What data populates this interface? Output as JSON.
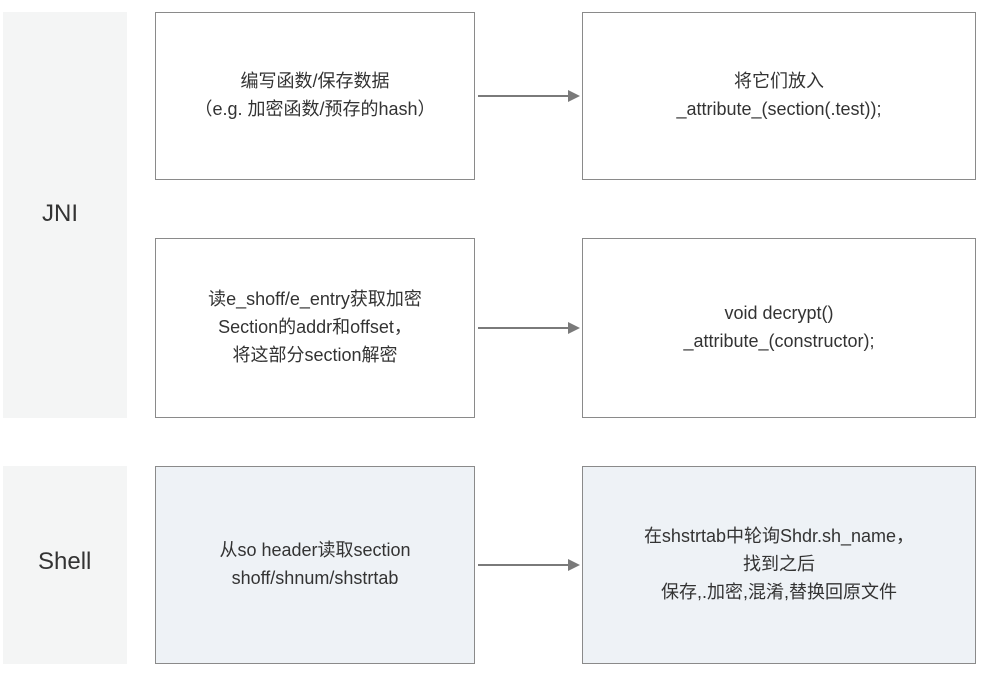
{
  "sections": {
    "jni": {
      "label": "JNI"
    },
    "shell": {
      "label": "Shell"
    }
  },
  "jni_row1": {
    "left": {
      "line1": "编写函数/保存数据",
      "line2": "（e.g. 加密函数/预存的hash）"
    },
    "right": {
      "line1": "将它们放入",
      "line2": "_attribute_(section(.test));"
    }
  },
  "jni_row2": {
    "left": {
      "line1": "读e_shoff/e_entry获取加密",
      "line2": "Section的addr和offset，",
      "line3": "将这部分section解密"
    },
    "right": {
      "line1": "void decrypt()",
      "line2": "_attribute_(constructor);"
    }
  },
  "shell_row": {
    "left": {
      "line1": "从so header读取section",
      "line2": "shoff/shnum/shstrtab"
    },
    "right": {
      "line1": "在shstrtab中轮询Shdr.sh_name，",
      "line2": "找到之后",
      "line3": "保存,.加密,混淆,替换回原文件"
    }
  }
}
